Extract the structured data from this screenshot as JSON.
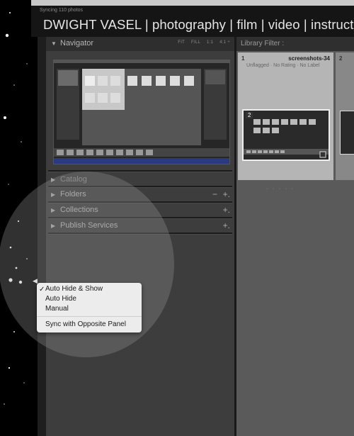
{
  "window": {
    "sync_status": "Syncing 110 photos",
    "identity_plate": "DWIGHT VASEL | photography | film | video | instructor"
  },
  "left_panel": {
    "navigator": {
      "label": "Navigator",
      "modes": [
        "FIT",
        "FILL",
        "1:1",
        "4:1 ÷"
      ]
    },
    "catalog": {
      "label": "Catalog"
    },
    "folders": {
      "label": "Folders",
      "remove": "−",
      "add": "+."
    },
    "collections": {
      "label": "Collections",
      "add": "+."
    },
    "publish_services": {
      "label": "Publish Services",
      "add": "+."
    }
  },
  "library_filter": {
    "label": "Library Filter :"
  },
  "grid": {
    "cells": [
      {
        "index": "1",
        "name": "screenshots-34",
        "meta": "Unflagged · No Rating · No Label",
        "thumb_badge": "2"
      },
      {
        "index": "2"
      }
    ]
  },
  "context_menu": {
    "items": [
      {
        "label": "Auto Hide & Show",
        "checked": true
      },
      {
        "label": "Auto Hide",
        "checked": false
      },
      {
        "label": "Manual",
        "checked": false
      },
      {
        "label": "Sync with Opposite Panel",
        "checked": false
      }
    ],
    "check_mark": "✓"
  },
  "colors": {
    "panel_bg": "#3d3d3d",
    "grid_bg": "#5a5a5a",
    "selected_cell": "#b5b5b5",
    "menu_bg": "#ececec"
  }
}
